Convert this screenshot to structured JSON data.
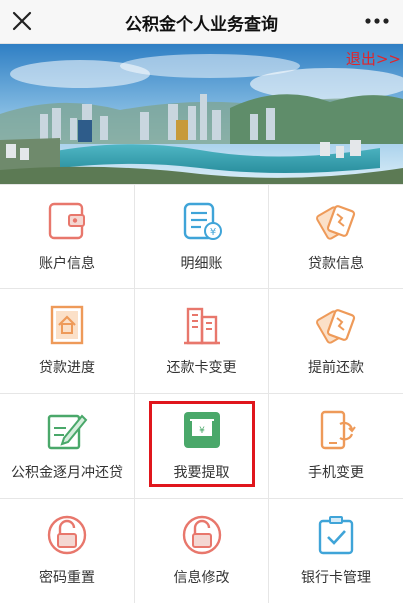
{
  "header": {
    "title": "公积金个人业务查询"
  },
  "banner": {
    "logout_label": "退出>>"
  },
  "menu": [
    {
      "label": "账户信息",
      "icon": "wallet-icon"
    },
    {
      "label": "明细账",
      "icon": "statement-icon"
    },
    {
      "label": "贷款信息",
      "icon": "loan-cards-icon"
    },
    {
      "label": "贷款进度",
      "icon": "house-document-icon"
    },
    {
      "label": "还款卡变更",
      "icon": "building-icon"
    },
    {
      "label": "提前还款",
      "icon": "loan-cards-icon"
    },
    {
      "label": "公积金逐月冲还贷",
      "icon": "edit-document-icon"
    },
    {
      "label": "我要提取",
      "icon": "atm-withdraw-icon",
      "highlighted": true
    },
    {
      "label": "手机变更",
      "icon": "phone-sync-icon"
    },
    {
      "label": "密码重置",
      "icon": "unlock-icon"
    },
    {
      "label": "信息修改",
      "icon": "unlock-icon"
    },
    {
      "label": "银行卡管理",
      "icon": "card-check-icon"
    }
  ],
  "colors": {
    "coral": "#e8776c",
    "blue": "#3fa4d8",
    "orange": "#ee9a59",
    "green": "#4aa86a",
    "highlight": "#e0161c"
  }
}
